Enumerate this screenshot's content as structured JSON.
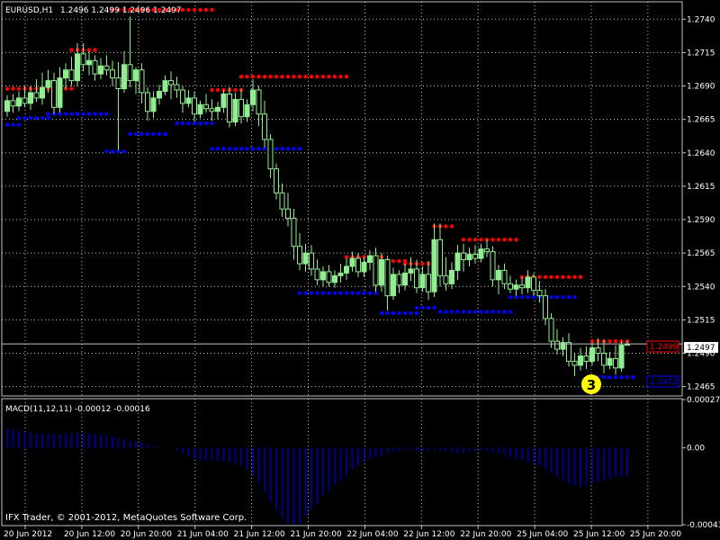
{
  "colors": {
    "background": "#000000",
    "grid": "#c0c0c0",
    "frame": "#c0c0c0",
    "bull_candle": "#90ee90",
    "bear_candle": "#000000",
    "upper_dots": "#ff0000",
    "lower_dots": "#0000ff",
    "macd_bars": "#00008b",
    "text": "#ffffff",
    "badge": "#ffff00"
  },
  "header": {
    "symbol": "EURUSD,H1",
    "ohlc": "1.2496 1.2499 1.2496 1.2497"
  },
  "indicator": {
    "label": "MACD(11,12,11) -0.00012 -0.00016",
    "ticks": [
      "0.00027",
      "0.00",
      "-0.00043"
    ]
  },
  "footer": {
    "copyright": "IFX Trader, © 2001-2012, MetaQuotes Software Corp."
  },
  "price_axis": {
    "ticks": [
      "1.2740",
      "1.2715",
      "1.2690",
      "1.2665",
      "1.2640",
      "1.2615",
      "1.2590",
      "1.2565",
      "1.2540",
      "1.2515",
      "1.2490",
      "1.2465"
    ],
    "current_price": "1.2497",
    "upper_label": "1.2499",
    "lower_label": "1.2472"
  },
  "time_axis": {
    "ticks": [
      "20 Jun 2012",
      "20 Jun 12:00",
      "20 Jun 20:00",
      "21 Jun 04:00",
      "21 Jun 12:00",
      "21 Jun 20:00",
      "22 Jun 04:00",
      "22 Jun 12:00",
      "22 Jun 20:00",
      "25 Jun 04:00",
      "25 Jun 12:00",
      "25 Jun 20:00"
    ]
  },
  "badge": {
    "text": "3"
  },
  "chart_data": {
    "type": "candlestick",
    "symbol": "EURUSD",
    "timeframe": "H1",
    "ylim": [
      1.2458,
      1.2753
    ],
    "candles": [
      {
        "o": 1.2671,
        "h": 1.2683,
        "l": 1.2667,
        "c": 1.2679
      },
      {
        "o": 1.2679,
        "h": 1.2684,
        "l": 1.267,
        "c": 1.2675
      },
      {
        "o": 1.2675,
        "h": 1.2686,
        "l": 1.2671,
        "c": 1.2681
      },
      {
        "o": 1.2681,
        "h": 1.269,
        "l": 1.2674,
        "c": 1.2677
      },
      {
        "o": 1.2677,
        "h": 1.269,
        "l": 1.2672,
        "c": 1.2685
      },
      {
        "o": 1.2685,
        "h": 1.2695,
        "l": 1.2678,
        "c": 1.2681
      },
      {
        "o": 1.2681,
        "h": 1.27,
        "l": 1.2676,
        "c": 1.2689
      },
      {
        "o": 1.2689,
        "h": 1.2702,
        "l": 1.2685,
        "c": 1.2694
      },
      {
        "o": 1.2694,
        "h": 1.27,
        "l": 1.2669,
        "c": 1.2674
      },
      {
        "o": 1.2674,
        "h": 1.2704,
        "l": 1.267,
        "c": 1.2696
      },
      {
        "o": 1.2696,
        "h": 1.2707,
        "l": 1.2688,
        "c": 1.2702
      },
      {
        "o": 1.2702,
        "h": 1.2712,
        "l": 1.269,
        "c": 1.2694
      },
      {
        "o": 1.2694,
        "h": 1.2722,
        "l": 1.269,
        "c": 1.2714
      },
      {
        "o": 1.2714,
        "h": 1.2722,
        "l": 1.2701,
        "c": 1.2706
      },
      {
        "o": 1.2706,
        "h": 1.2716,
        "l": 1.2698,
        "c": 1.2709
      },
      {
        "o": 1.2709,
        "h": 1.2713,
        "l": 1.2694,
        "c": 1.2699
      },
      {
        "o": 1.2699,
        "h": 1.2711,
        "l": 1.2695,
        "c": 1.2705
      },
      {
        "o": 1.2705,
        "h": 1.2713,
        "l": 1.2698,
        "c": 1.2702
      },
      {
        "o": 1.2702,
        "h": 1.2709,
        "l": 1.269,
        "c": 1.2696
      },
      {
        "o": 1.2696,
        "h": 1.2708,
        "l": 1.2642,
        "c": 1.2688
      },
      {
        "o": 1.2688,
        "h": 1.2716,
        "l": 1.2685,
        "c": 1.2706
      },
      {
        "o": 1.2706,
        "h": 1.2742,
        "l": 1.2689,
        "c": 1.2694
      },
      {
        "o": 1.2694,
        "h": 1.2704,
        "l": 1.2684,
        "c": 1.2702
      },
      {
        "o": 1.2702,
        "h": 1.2707,
        "l": 1.2677,
        "c": 1.2685
      },
      {
        "o": 1.2685,
        "h": 1.2689,
        "l": 1.2664,
        "c": 1.2671
      },
      {
        "o": 1.2671,
        "h": 1.2686,
        "l": 1.2666,
        "c": 1.2681
      },
      {
        "o": 1.2681,
        "h": 1.2691,
        "l": 1.2676,
        "c": 1.2686
      },
      {
        "o": 1.2686,
        "h": 1.2698,
        "l": 1.2683,
        "c": 1.2694
      },
      {
        "o": 1.2694,
        "h": 1.2701,
        "l": 1.268,
        "c": 1.2691
      },
      {
        "o": 1.2691,
        "h": 1.2697,
        "l": 1.2681,
        "c": 1.2687
      },
      {
        "o": 1.2687,
        "h": 1.269,
        "l": 1.267,
        "c": 1.2677
      },
      {
        "o": 1.2677,
        "h": 1.2687,
        "l": 1.2674,
        "c": 1.2681
      },
      {
        "o": 1.2681,
        "h": 1.2686,
        "l": 1.2664,
        "c": 1.2669
      },
      {
        "o": 1.2669,
        "h": 1.2679,
        "l": 1.2666,
        "c": 1.2676
      },
      {
        "o": 1.2676,
        "h": 1.2684,
        "l": 1.267,
        "c": 1.2673
      },
      {
        "o": 1.2673,
        "h": 1.268,
        "l": 1.2664,
        "c": 1.2671
      },
      {
        "o": 1.2671,
        "h": 1.2678,
        "l": 1.2665,
        "c": 1.2674
      },
      {
        "o": 1.2674,
        "h": 1.2687,
        "l": 1.267,
        "c": 1.2684
      },
      {
        "o": 1.2684,
        "h": 1.2689,
        "l": 1.2659,
        "c": 1.2663
      },
      {
        "o": 1.2663,
        "h": 1.2685,
        "l": 1.266,
        "c": 1.268
      },
      {
        "o": 1.268,
        "h": 1.2688,
        "l": 1.2662,
        "c": 1.2667
      },
      {
        "o": 1.2667,
        "h": 1.268,
        "l": 1.2663,
        "c": 1.2676
      },
      {
        "o": 1.2676,
        "h": 1.2695,
        "l": 1.2671,
        "c": 1.2687
      },
      {
        "o": 1.2687,
        "h": 1.269,
        "l": 1.266,
        "c": 1.2669
      },
      {
        "o": 1.2669,
        "h": 1.2679,
        "l": 1.2644,
        "c": 1.265
      },
      {
        "o": 1.265,
        "h": 1.2654,
        "l": 1.2621,
        "c": 1.2628
      },
      {
        "o": 1.2628,
        "h": 1.2632,
        "l": 1.2605,
        "c": 1.261
      },
      {
        "o": 1.261,
        "h": 1.2617,
        "l": 1.2592,
        "c": 1.2598
      },
      {
        "o": 1.2598,
        "h": 1.261,
        "l": 1.2585,
        "c": 1.2591
      },
      {
        "o": 1.2591,
        "h": 1.2598,
        "l": 1.256,
        "c": 1.257
      },
      {
        "o": 1.257,
        "h": 1.258,
        "l": 1.2552,
        "c": 1.2557
      },
      {
        "o": 1.2557,
        "h": 1.2572,
        "l": 1.2551,
        "c": 1.2565
      },
      {
        "o": 1.2565,
        "h": 1.2571,
        "l": 1.2548,
        "c": 1.2553
      },
      {
        "o": 1.2553,
        "h": 1.256,
        "l": 1.2541,
        "c": 1.2545
      },
      {
        "o": 1.2545,
        "h": 1.2555,
        "l": 1.254,
        "c": 1.2551
      },
      {
        "o": 1.2551,
        "h": 1.2556,
        "l": 1.254,
        "c": 1.2543
      },
      {
        "o": 1.2543,
        "h": 1.2552,
        "l": 1.2539,
        "c": 1.2548
      },
      {
        "o": 1.2548,
        "h": 1.2557,
        "l": 1.2543,
        "c": 1.255
      },
      {
        "o": 1.255,
        "h": 1.2561,
        "l": 1.2545,
        "c": 1.2555
      },
      {
        "o": 1.2555,
        "h": 1.2566,
        "l": 1.2551,
        "c": 1.2561
      },
      {
        "o": 1.2561,
        "h": 1.2565,
        "l": 1.2547,
        "c": 1.2551
      },
      {
        "o": 1.2551,
        "h": 1.2562,
        "l": 1.2547,
        "c": 1.2558
      },
      {
        "o": 1.2558,
        "h": 1.2567,
        "l": 1.2552,
        "c": 1.2563
      },
      {
        "o": 1.2563,
        "h": 1.2569,
        "l": 1.2536,
        "c": 1.2541
      },
      {
        "o": 1.2541,
        "h": 1.2565,
        "l": 1.2536,
        "c": 1.256
      },
      {
        "o": 1.256,
        "h": 1.2563,
        "l": 1.2522,
        "c": 1.2533
      },
      {
        "o": 1.2533,
        "h": 1.2554,
        "l": 1.253,
        "c": 1.2549
      },
      {
        "o": 1.2549,
        "h": 1.2552,
        "l": 1.2535,
        "c": 1.2541
      },
      {
        "o": 1.2541,
        "h": 1.2557,
        "l": 1.2537,
        "c": 1.255
      },
      {
        "o": 1.255,
        "h": 1.2562,
        "l": 1.2544,
        "c": 1.2553
      },
      {
        "o": 1.2553,
        "h": 1.256,
        "l": 1.2535,
        "c": 1.2539
      },
      {
        "o": 1.2539,
        "h": 1.2555,
        "l": 1.2536,
        "c": 1.2549
      },
      {
        "o": 1.2549,
        "h": 1.2559,
        "l": 1.253,
        "c": 1.2536
      },
      {
        "o": 1.2536,
        "h": 1.2587,
        "l": 1.2532,
        "c": 1.2575
      },
      {
        "o": 1.2575,
        "h": 1.2587,
        "l": 1.254,
        "c": 1.2548
      },
      {
        "o": 1.2548,
        "h": 1.2562,
        "l": 1.2537,
        "c": 1.2542
      },
      {
        "o": 1.2542,
        "h": 1.2558,
        "l": 1.2538,
        "c": 1.2552
      },
      {
        "o": 1.2552,
        "h": 1.2571,
        "l": 1.2545,
        "c": 1.2565
      },
      {
        "o": 1.2565,
        "h": 1.2572,
        "l": 1.2551,
        "c": 1.256
      },
      {
        "o": 1.256,
        "h": 1.2569,
        "l": 1.2555,
        "c": 1.2564
      },
      {
        "o": 1.2564,
        "h": 1.2571,
        "l": 1.2557,
        "c": 1.2561
      },
      {
        "o": 1.2561,
        "h": 1.2572,
        "l": 1.2558,
        "c": 1.2568
      },
      {
        "o": 1.2568,
        "h": 1.2575,
        "l": 1.2562,
        "c": 1.2566
      },
      {
        "o": 1.2566,
        "h": 1.257,
        "l": 1.254,
        "c": 1.2545
      },
      {
        "o": 1.2545,
        "h": 1.2556,
        "l": 1.2534,
        "c": 1.2552
      },
      {
        "o": 1.2552,
        "h": 1.2557,
        "l": 1.2538,
        "c": 1.2542
      },
      {
        "o": 1.2542,
        "h": 1.2548,
        "l": 1.2535,
        "c": 1.2538
      },
      {
        "o": 1.2538,
        "h": 1.2545,
        "l": 1.2533,
        "c": 1.2541
      },
      {
        "o": 1.2541,
        "h": 1.2547,
        "l": 1.2534,
        "c": 1.2539
      },
      {
        "o": 1.2539,
        "h": 1.2552,
        "l": 1.2535,
        "c": 1.2547
      },
      {
        "o": 1.2547,
        "h": 1.255,
        "l": 1.2533,
        "c": 1.2537
      },
      {
        "o": 1.2537,
        "h": 1.2544,
        "l": 1.2528,
        "c": 1.2533
      },
      {
        "o": 1.2533,
        "h": 1.2538,
        "l": 1.2511,
        "c": 1.2516
      },
      {
        "o": 1.2516,
        "h": 1.252,
        "l": 1.2494,
        "c": 1.2499
      },
      {
        "o": 1.2499,
        "h": 1.2508,
        "l": 1.2489,
        "c": 1.2493
      },
      {
        "o": 1.2493,
        "h": 1.2502,
        "l": 1.2488,
        "c": 1.2498
      },
      {
        "o": 1.2498,
        "h": 1.2505,
        "l": 1.248,
        "c": 1.2484
      },
      {
        "o": 1.2484,
        "h": 1.249,
        "l": 1.2473,
        "c": 1.2481
      },
      {
        "o": 1.2481,
        "h": 1.2494,
        "l": 1.2477,
        "c": 1.2488
      },
      {
        "o": 1.2488,
        "h": 1.2495,
        "l": 1.2478,
        "c": 1.2484
      },
      {
        "o": 1.2484,
        "h": 1.2498,
        "l": 1.2481,
        "c": 1.2494
      },
      {
        "o": 1.2494,
        "h": 1.2501,
        "l": 1.2484,
        "c": 1.249
      },
      {
        "o": 1.249,
        "h": 1.25,
        "l": 1.2475,
        "c": 1.2481
      },
      {
        "o": 1.2481,
        "h": 1.2491,
        "l": 1.2478,
        "c": 1.2486
      },
      {
        "o": 1.2486,
        "h": 1.2496,
        "l": 1.2474,
        "c": 1.2479
      },
      {
        "o": 1.2479,
        "h": 1.2499,
        "l": 1.2476,
        "c": 1.2496
      },
      {
        "o": 1.2496,
        "h": 1.2499,
        "l": 1.2496,
        "c": 1.2497
      }
    ],
    "upper_levels": [
      {
        "from": 0,
        "to": 11,
        "v": 1.2688
      },
      {
        "from": 11,
        "to": 15,
        "v": 1.2717
      },
      {
        "from": 18,
        "to": 35,
        "v": 1.2747
      },
      {
        "from": 35,
        "to": 40,
        "v": 1.2687
      },
      {
        "from": 40,
        "to": 58,
        "v": 1.2697
      },
      {
        "from": 58,
        "to": 64,
        "v": 1.2562
      },
      {
        "from": 64,
        "to": 68,
        "v": 1.2559
      },
      {
        "from": 68,
        "to": 73,
        "v": 1.2557
      },
      {
        "from": 73,
        "to": 76,
        "v": 1.2585
      },
      {
        "from": 78,
        "to": 87,
        "v": 1.2575
      },
      {
        "from": 88,
        "to": 98,
        "v": 1.2547
      },
      {
        "from": 100,
        "to": 106,
        "v": 1.2499
      }
    ],
    "lower_levels": [
      {
        "from": 0,
        "to": 2,
        "v": 1.2661
      },
      {
        "from": 2,
        "to": 7,
        "v": 1.2666
      },
      {
        "from": 7,
        "to": 17,
        "v": 1.2669
      },
      {
        "from": 17,
        "to": 20,
        "v": 1.2641
      },
      {
        "from": 21,
        "to": 27,
        "v": 1.2654
      },
      {
        "from": 29,
        "to": 35,
        "v": 1.2662
      },
      {
        "from": 35,
        "to": 50,
        "v": 1.2643
      },
      {
        "from": 50,
        "to": 63,
        "v": 1.2535
      },
      {
        "from": 64,
        "to": 70,
        "v": 1.252
      },
      {
        "from": 70,
        "to": 73,
        "v": 1.2524
      },
      {
        "from": 74,
        "to": 86,
        "v": 1.2521
      },
      {
        "from": 86,
        "to": 97,
        "v": 1.2532
      },
      {
        "from": 100,
        "to": 107,
        "v": 1.2472
      }
    ],
    "macd": {
      "ylim": [
        -0.00043,
        0.00027
      ],
      "values": [
        0.00011,
        0.0001,
        9.5e-05,
        9e-05,
        8.5e-05,
        8e-05,
        7.8e-05,
        7.7e-05,
        7.5e-05,
        7.8e-05,
        8e-05,
        8.2e-05,
        8.3e-05,
        8.5e-05,
        8.3e-05,
        8e-05,
        7.5e-05,
        7e-05,
        6.2e-05,
        5.5e-05,
        4.8e-05,
        4e-05,
        3.5e-05,
        3e-05,
        2e-05,
        1e-05,
        4e-06,
        2e-06,
        1e-06,
        -1e-05,
        -3e-05,
        -5e-05,
        -6e-05,
        -7e-05,
        -7e-05,
        -7e-05,
        -7.2e-05,
        -7.5e-05,
        -8e-05,
        -9e-05,
        -0.0001,
        -0.00012,
        -0.00015,
        -0.0002,
        -0.00025,
        -0.0003,
        -0.00035,
        -0.00039,
        -0.00042,
        -0.00043,
        -0.00042,
        -0.00038,
        -0.00035,
        -0.00031,
        -0.00027,
        -0.00024,
        -0.00021,
        -0.00018,
        -0.00015,
        -0.00012,
        -0.0001,
        -8e-05,
        -6e-05,
        -5e-05,
        -4e-05,
        -3e-05,
        -2e-05,
        -1.5e-05,
        -1e-05,
        -1e-05,
        -1.5e-05,
        -2e-05,
        -1.5e-05,
        -1e-05,
        -1.5e-05,
        -2e-05,
        -2.5e-05,
        -3e-05,
        -3e-05,
        -2.5e-05,
        -2e-05,
        -1.5e-05,
        -1.5e-05,
        -2.5e-05,
        -3e-05,
        -4e-05,
        -5e-05,
        -6e-05,
        -7e-05,
        -8e-05,
        -9e-05,
        -0.0001,
        -0.00012,
        -0.00014,
        -0.00016,
        -0.00018,
        -0.0002,
        -0.00021,
        -0.00022,
        -0.00021,
        -0.0002,
        -0.00019,
        -0.00018,
        -0.00017,
        -0.00016,
        -0.00016,
        -0.00016
      ]
    }
  }
}
